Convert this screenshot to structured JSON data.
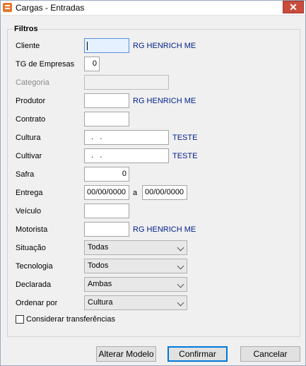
{
  "window": {
    "title": "Cargas - Entradas",
    "close_glyph": "✕"
  },
  "filters": {
    "group_title": "Filtros",
    "cliente": {
      "label": "Cliente",
      "value": "",
      "desc": "RG HENRICH ME"
    },
    "tg_empresas": {
      "label": "TG de Empresas",
      "value": "0"
    },
    "categoria": {
      "label": "Categoria",
      "value": ""
    },
    "produtor": {
      "label": "Produtor",
      "value": "",
      "desc": "RG HENRICH ME"
    },
    "contrato": {
      "label": "Contrato",
      "value": ""
    },
    "cultura": {
      "label": "Cultura",
      "value": "  .   .",
      "desc": "TESTE"
    },
    "cultivar": {
      "label": "Cultivar",
      "value": "  .   .",
      "desc": "TESTE"
    },
    "safra": {
      "label": "Safra",
      "value": "0"
    },
    "entrega": {
      "label": "Entrega",
      "from": "00/00/0000",
      "sep": "a",
      "to": "00/00/0000"
    },
    "veiculo": {
      "label": "Veículo",
      "value": ""
    },
    "motorista": {
      "label": "Motorista",
      "value": "",
      "desc": "RG HENRICH ME"
    },
    "situacao": {
      "label": "Situação",
      "value": "Todas"
    },
    "tecnologia": {
      "label": "Tecnologia",
      "value": "Todos"
    },
    "declarada": {
      "label": "Declarada",
      "value": "Ambas"
    },
    "ordenar": {
      "label": "Ordenar por",
      "value": "Cultura"
    },
    "transferencias": {
      "label": "Considerar transferências",
      "checked": false
    }
  },
  "buttons": {
    "alterar": "Alterar Modelo",
    "confirmar": "Confirmar",
    "cancelar": "Cancelar"
  }
}
